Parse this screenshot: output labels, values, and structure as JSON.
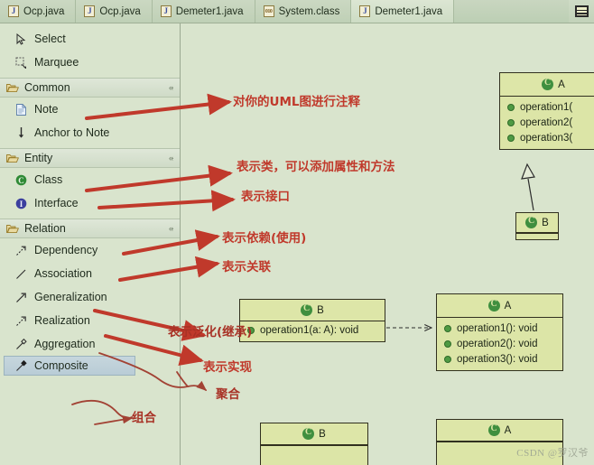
{
  "window": {
    "background_color": "#d9e4cd"
  },
  "tabbar": {
    "tabs": [
      {
        "label": "Ocp.java",
        "icon": "java-file-icon",
        "active": false
      },
      {
        "label": "Ocp.java",
        "icon": "java-file-icon",
        "active": false
      },
      {
        "label": "Demeter1.java",
        "icon": "java-file-icon",
        "active": false
      },
      {
        "label": "System.class",
        "icon": "class-file-icon",
        "active": false
      },
      {
        "label": "Demeter1.java",
        "icon": "java-file-icon",
        "active": true
      }
    ],
    "menu_button": "tab-list-menu"
  },
  "palette": {
    "tools": [
      {
        "label": "Select",
        "icon": "cursor-arrow-icon"
      },
      {
        "label": "Marquee",
        "icon": "marquee-select-icon"
      }
    ],
    "groups": [
      {
        "label": "Common",
        "icon": "folder-open-icon",
        "collapse_icon": "collapse-chevrons-icon",
        "items": [
          {
            "label": "Note",
            "icon": "note-document-icon",
            "selected": false
          },
          {
            "label": "Anchor to Note",
            "icon": "anchor-arrow-icon",
            "selected": false
          }
        ]
      },
      {
        "label": "Entity",
        "icon": "folder-open-icon",
        "collapse_icon": "collapse-chevrons-icon",
        "items": [
          {
            "label": "Class",
            "icon": "class-circle-icon",
            "selected": false
          },
          {
            "label": "Interface",
            "icon": "interface-circle-icon",
            "selected": false
          }
        ]
      },
      {
        "label": "Relation",
        "icon": "folder-open-icon",
        "collapse_icon": "collapse-chevrons-icon",
        "items": [
          {
            "label": "Dependency",
            "icon": "dependency-arrow-icon",
            "selected": false
          },
          {
            "label": "Association",
            "icon": "association-line-icon",
            "selected": false
          },
          {
            "label": "Generalization",
            "icon": "generalization-arrow-icon",
            "selected": false
          },
          {
            "label": "Realization",
            "icon": "realization-arrow-icon",
            "selected": false
          },
          {
            "label": "Aggregation",
            "icon": "aggregation-diamond-icon",
            "selected": false
          },
          {
            "label": "Composite",
            "icon": "composite-diamond-icon",
            "selected": true
          }
        ]
      }
    ]
  },
  "annotations": [
    {
      "id": "note-anno",
      "text": "对你的UML图进行注释"
    },
    {
      "id": "class-anno",
      "text": "表示类，可以添加属性和方法"
    },
    {
      "id": "interface-anno",
      "text": "表示接口"
    },
    {
      "id": "dependency-anno",
      "text": "表示依赖(使用)"
    },
    {
      "id": "association-anno",
      "text": "表示关联"
    },
    {
      "id": "generalization-anno",
      "text": "表示泛化(继承)"
    },
    {
      "id": "realization-anno",
      "text": "表示实现"
    },
    {
      "id": "aggregation-anno",
      "text": "聚合"
    },
    {
      "id": "composite-anno",
      "text": "组合"
    }
  ],
  "diagram": {
    "classes": [
      {
        "id": "class-a-topright",
        "name": "A",
        "stereotype_icon": "class-circle-icon",
        "operations": [
          "operation1(",
          "operation2(",
          "operation3("
        ]
      },
      {
        "id": "class-b-topright",
        "name": "B",
        "stereotype_icon": "class-circle-icon",
        "operations": []
      },
      {
        "id": "class-b-middle",
        "name": "B",
        "stereotype_icon": "class-circle-icon",
        "operations": [
          "operation1(a: A): void"
        ]
      },
      {
        "id": "class-a-middle",
        "name": "A",
        "stereotype_icon": "class-circle-icon",
        "operations": [
          "operation1(): void",
          "operation2(): void",
          "operation3(): void"
        ]
      },
      {
        "id": "class-b-bottom",
        "name": "B",
        "stereotype_icon": "class-circle-icon",
        "operations": []
      },
      {
        "id": "class-a-bottom",
        "name": "A",
        "stereotype_icon": "class-circle-icon",
        "operations": []
      }
    ],
    "relations": [
      {
        "type": "generalization",
        "from": "class-b-topright",
        "to": "class-a-topright"
      },
      {
        "type": "dependency",
        "from": "class-b-middle",
        "to": "class-a-middle"
      }
    ]
  },
  "watermark": {
    "text": "CSDN @罗汉爷"
  },
  "colors": {
    "canvas": "#d9e4cd",
    "uml_fill": "#dce5a7",
    "uml_border": "#31301f",
    "annotation_red": "#c0392b",
    "accent_green": "#3f8f3f"
  }
}
